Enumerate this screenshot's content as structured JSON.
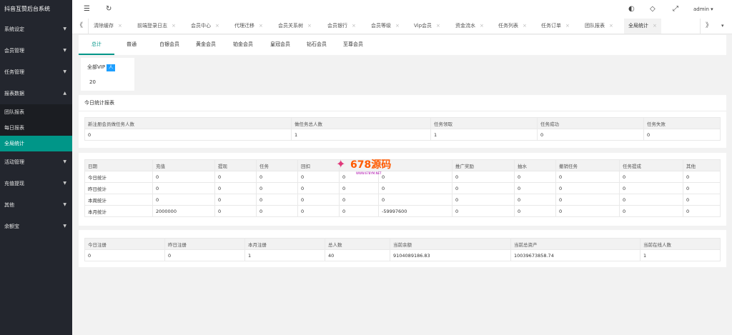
{
  "app_title": "抖音互赞后台系统",
  "sidebar": {
    "items": [
      {
        "label": "系统设定",
        "arrow": "▼"
      },
      {
        "label": "会员管理",
        "arrow": "▼"
      },
      {
        "label": "任务管理",
        "arrow": "▼"
      },
      {
        "label": "报表数据",
        "arrow": "▲"
      }
    ],
    "sub_items": [
      {
        "label": "团队报表"
      },
      {
        "label": "每日报表"
      },
      {
        "label": "全局统计"
      }
    ],
    "items_after": [
      {
        "label": "活动管理",
        "arrow": "▼"
      },
      {
        "label": "充值提现",
        "arrow": "▼"
      },
      {
        "label": "其他",
        "arrow": "▼"
      },
      {
        "label": "余额宝",
        "arrow": "▼"
      }
    ]
  },
  "header": {
    "user": "admin ▾",
    "menu_icon": "☰",
    "refresh_icon": "↻",
    "theme_icon": "◐",
    "tag_icon": "◇",
    "fullscreen_icon": "⤢"
  },
  "tabs": {
    "left_arrow": "《",
    "right_arrow": "》",
    "more_arrow": "▾",
    "close": "×",
    "items": [
      "清除缓存",
      "前端登录日志",
      "会员中心",
      "代理迁移",
      "会员关系树",
      "会员银行",
      "会员等级",
      "Vip会员",
      "资金流水",
      "任务列表",
      "任务订单",
      "团队报表",
      "全局统计"
    ]
  },
  "subtabs": [
    "总计",
    "普通",
    "白银会员",
    "黄金会员",
    "铂金会员",
    "皇冠会员",
    "钻石会员",
    "至尊会员"
  ],
  "vip_card": {
    "label": "全部VIP",
    "badge": "人",
    "value": "20"
  },
  "today_report": {
    "title": "今日统计报表",
    "headers": [
      "新注册会员做任务人数",
      "做任务总人数",
      "任务领取",
      "任务成功",
      "任务失败"
    ],
    "values": [
      "0",
      "1",
      "1",
      "0",
      "0"
    ]
  },
  "stats_table": {
    "headers": [
      "日期",
      "充值",
      "提现",
      "任务",
      "回扣",
      "",
      "",
      "推广奖励",
      "抽水",
      "撤销任务",
      "任务提成",
      "其他"
    ],
    "rows": [
      [
        "今日统计",
        "0",
        "0",
        "0",
        "0",
        "0",
        "0",
        "0",
        "0",
        "0",
        "0",
        "0"
      ],
      [
        "昨日统计",
        "0",
        "0",
        "0",
        "0",
        "0",
        "0",
        "0",
        "0",
        "0",
        "0",
        "0"
      ],
      [
        "本周统计",
        "0",
        "0",
        "0",
        "0",
        "0",
        "0",
        "0",
        "0",
        "0",
        "0",
        "0"
      ],
      [
        "本月统计",
        "2000000",
        "0",
        "0",
        "0",
        "0",
        "-59997600",
        "0",
        "0",
        "0",
        "0",
        "0"
      ]
    ]
  },
  "summary_table": {
    "headers": [
      "今日注册",
      "昨日注册",
      "本月注册",
      "总人数",
      "当前余额",
      "当前总资产",
      "当前在线人数"
    ],
    "values": [
      "0",
      "0",
      "1",
      "40",
      "9104089186.83",
      "10039673858.74",
      "1"
    ]
  },
  "watermark": {
    "brand": "678源码",
    "url": "WWW.678YM.NET"
  }
}
